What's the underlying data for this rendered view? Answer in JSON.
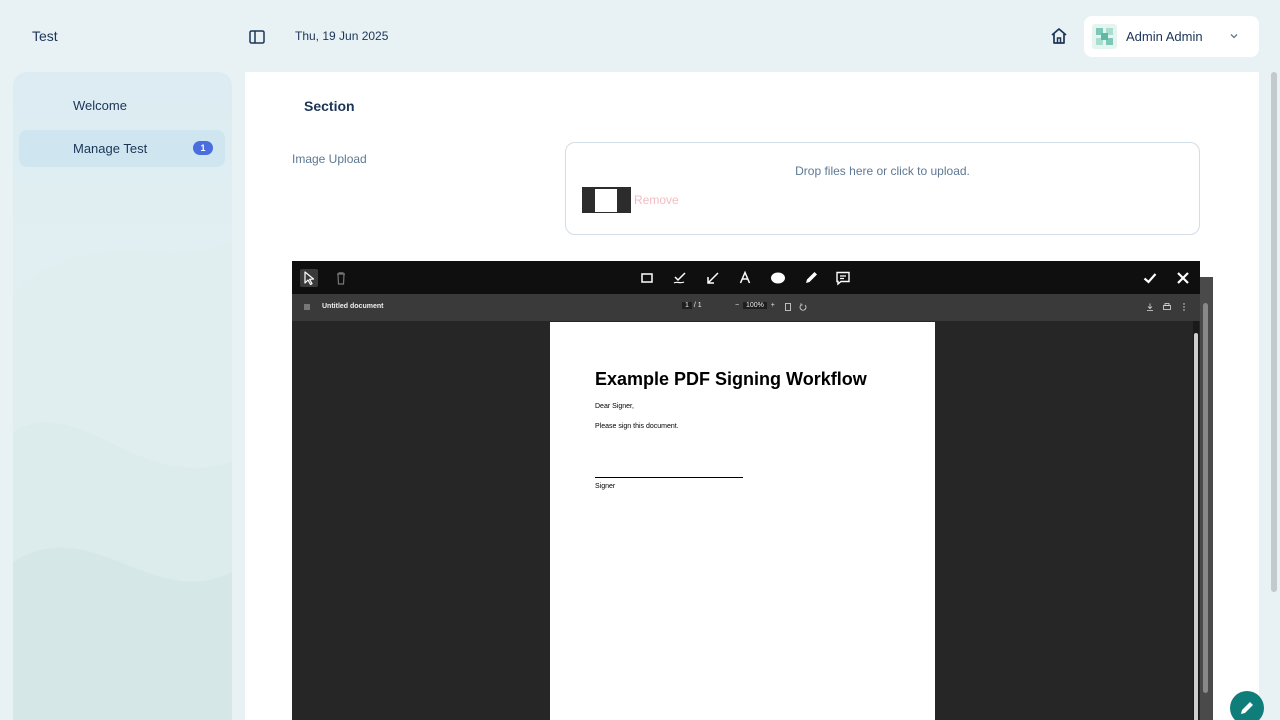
{
  "app": {
    "title": "Test",
    "date": "Thu, 19 Jun 2025"
  },
  "user": {
    "name": "Admin Admin"
  },
  "sidebar": {
    "items": [
      {
        "label": "Welcome"
      },
      {
        "label": "Manage Test",
        "badge": "1"
      }
    ]
  },
  "main": {
    "section_title": "Section",
    "upload": {
      "label": "Image Upload",
      "dropzone_text": "Drop files here or click to upload.",
      "remove_label": "Remove"
    }
  },
  "viewer": {
    "document_name": "Untitled document",
    "current_page": "1",
    "page_separator": "/ 1",
    "zoom": "100%",
    "pdf": {
      "title": "Example PDF Signing Workflow",
      "line1": "Dear Signer,",
      "line2": "Please sign this document.",
      "signature_label": "Signer"
    }
  },
  "colors": {
    "accent": "#0f7d7a",
    "badge": "#4a6ee0",
    "remove": "#f3bcc2"
  },
  "icons": [
    "sidebar-toggle-icon",
    "home-icon",
    "chevron-down-icon",
    "cursor-icon",
    "trash-icon",
    "rectangle-icon",
    "check-pen-icon",
    "arrow-icon",
    "text-icon",
    "ellipse-icon",
    "pen-icon",
    "comment-icon",
    "check-icon",
    "close-icon",
    "pencil-icon"
  ]
}
